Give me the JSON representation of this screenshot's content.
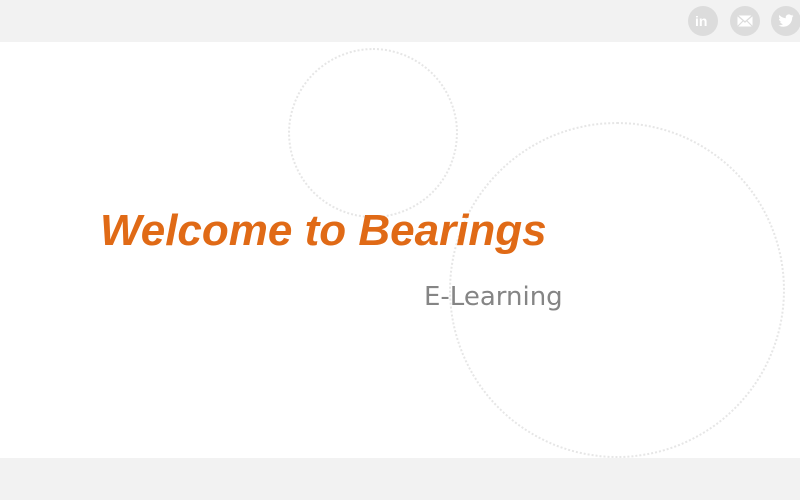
{
  "header": {
    "social": [
      {
        "icon": "linkedin-icon",
        "label": "in"
      },
      {
        "icon": "mail-icon"
      },
      {
        "icon": "twitter-icon"
      }
    ]
  },
  "main": {
    "title": "Welcome to Bearings",
    "subtitle": "E-Learning"
  },
  "colors": {
    "accent": "#e06a16",
    "subtitle": "#858585",
    "bar_background": "#f2f2f2",
    "icon_background": "#dcdcdc",
    "icon_foreground": "#ffffff"
  }
}
